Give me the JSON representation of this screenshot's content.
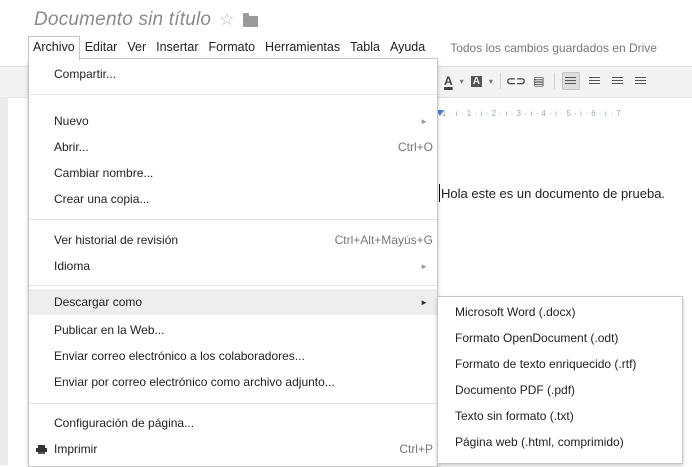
{
  "document": {
    "title": "Documento sin título",
    "body_text": "Hola este es un documento de prueba."
  },
  "menubar": {
    "items": [
      {
        "label": "Archivo",
        "active": true
      },
      {
        "label": "Editar"
      },
      {
        "label": "Ver"
      },
      {
        "label": "Insertar"
      },
      {
        "label": "Formato"
      },
      {
        "label": "Herramientas"
      },
      {
        "label": "Tabla"
      },
      {
        "label": "Ayuda"
      }
    ],
    "save_status": "Todos los cambios guardados en Drive"
  },
  "toolbar": {
    "text_color_label": "A",
    "highlight_label": "A",
    "ruler_text": "· 1 · ı · 1 · ı · 2 · ı · 3 · ı · 4 · ı · 5 · ı · 6 · ı · 7"
  },
  "file_menu": {
    "items": [
      {
        "label": "Compartir..."
      },
      {
        "label": "Nuevo",
        "has_submenu": true
      },
      {
        "label": "Abrir...",
        "shortcut": "Ctrl+O"
      },
      {
        "label": "Cambiar nombre..."
      },
      {
        "label": "Crear una copia..."
      },
      {
        "label": "Ver historial de revisión",
        "shortcut": "Ctrl+Alt+Mayús+G"
      },
      {
        "label": "Idioma",
        "has_submenu": true
      },
      {
        "label": "Descargar como",
        "has_submenu": true,
        "highlighted": true
      },
      {
        "label": "Publicar en la Web..."
      },
      {
        "label": "Enviar correo electrónico a los colaboradores..."
      },
      {
        "label": "Enviar por correo electrónico como archivo adjunto..."
      },
      {
        "label": "Configuración de página..."
      },
      {
        "label": "Imprimir",
        "shortcut": "Ctrl+P",
        "icon": "printer-icon"
      }
    ],
    "submenu_arrow": "►"
  },
  "download_submenu": {
    "items": [
      {
        "label": "Microsoft Word (.docx)"
      },
      {
        "label": "Formato OpenDocument (.odt)"
      },
      {
        "label": "Formato de texto enriquecido (.rtf)"
      },
      {
        "label": "Documento PDF (.pdf)"
      },
      {
        "label": "Texto sin formato (.txt)"
      },
      {
        "label": "Página web (.html, comprimido)"
      }
    ]
  },
  "colors": {
    "highlight_bg": "#eeeeee",
    "menu_border": "#c6c6c6",
    "title_gray": "#8a8a8a",
    "ruler_marker": "#4a7fd8"
  }
}
